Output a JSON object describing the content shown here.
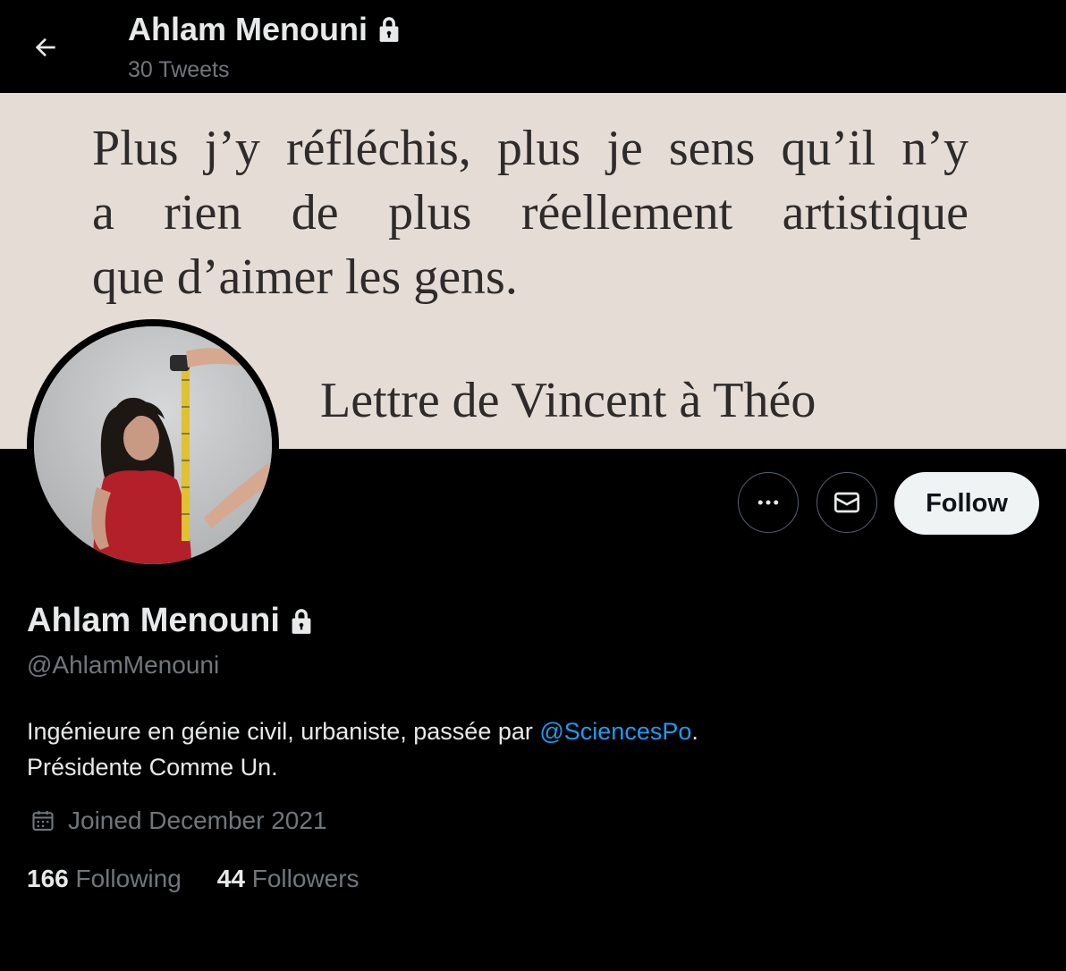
{
  "header": {
    "name": "Ahlam Menouni",
    "tweet_count": "30 Tweets",
    "back_icon": "arrow-left-icon",
    "lock_icon": "lock-icon"
  },
  "banner": {
    "lines": [
      "Plus j’y réfléchis, plus je sens qu’il n’y",
      "a rien de plus réellement artistique",
      "que d’aimer les gens."
    ],
    "signature": "Lettre de Vincent à Théo"
  },
  "actions": {
    "more_icon": "more-horizontal-icon",
    "message_icon": "envelope-icon",
    "follow_label": "Follow"
  },
  "profile": {
    "name": "Ahlam Menouni",
    "handle": "@AhlamMenouni",
    "bio_line1_prefix": "Ingénieure en génie civil, urbaniste, passée par ",
    "bio_link": "@SciencesPo",
    "bio_line1_suffix": ".",
    "bio_line2": "Présidente Comme Un.",
    "joined": "Joined December 2021",
    "calendar_icon": "calendar-icon"
  },
  "stats": {
    "following_count": "166",
    "following_label": "Following",
    "followers_count": "44",
    "followers_label": "Followers"
  },
  "colors": {
    "background": "#000000",
    "text": "#e7e9ea",
    "muted": "#71767b",
    "link": "#1d9bf0",
    "follow_bg": "#eff3f4",
    "banner_paper": "#e6dcd6"
  }
}
